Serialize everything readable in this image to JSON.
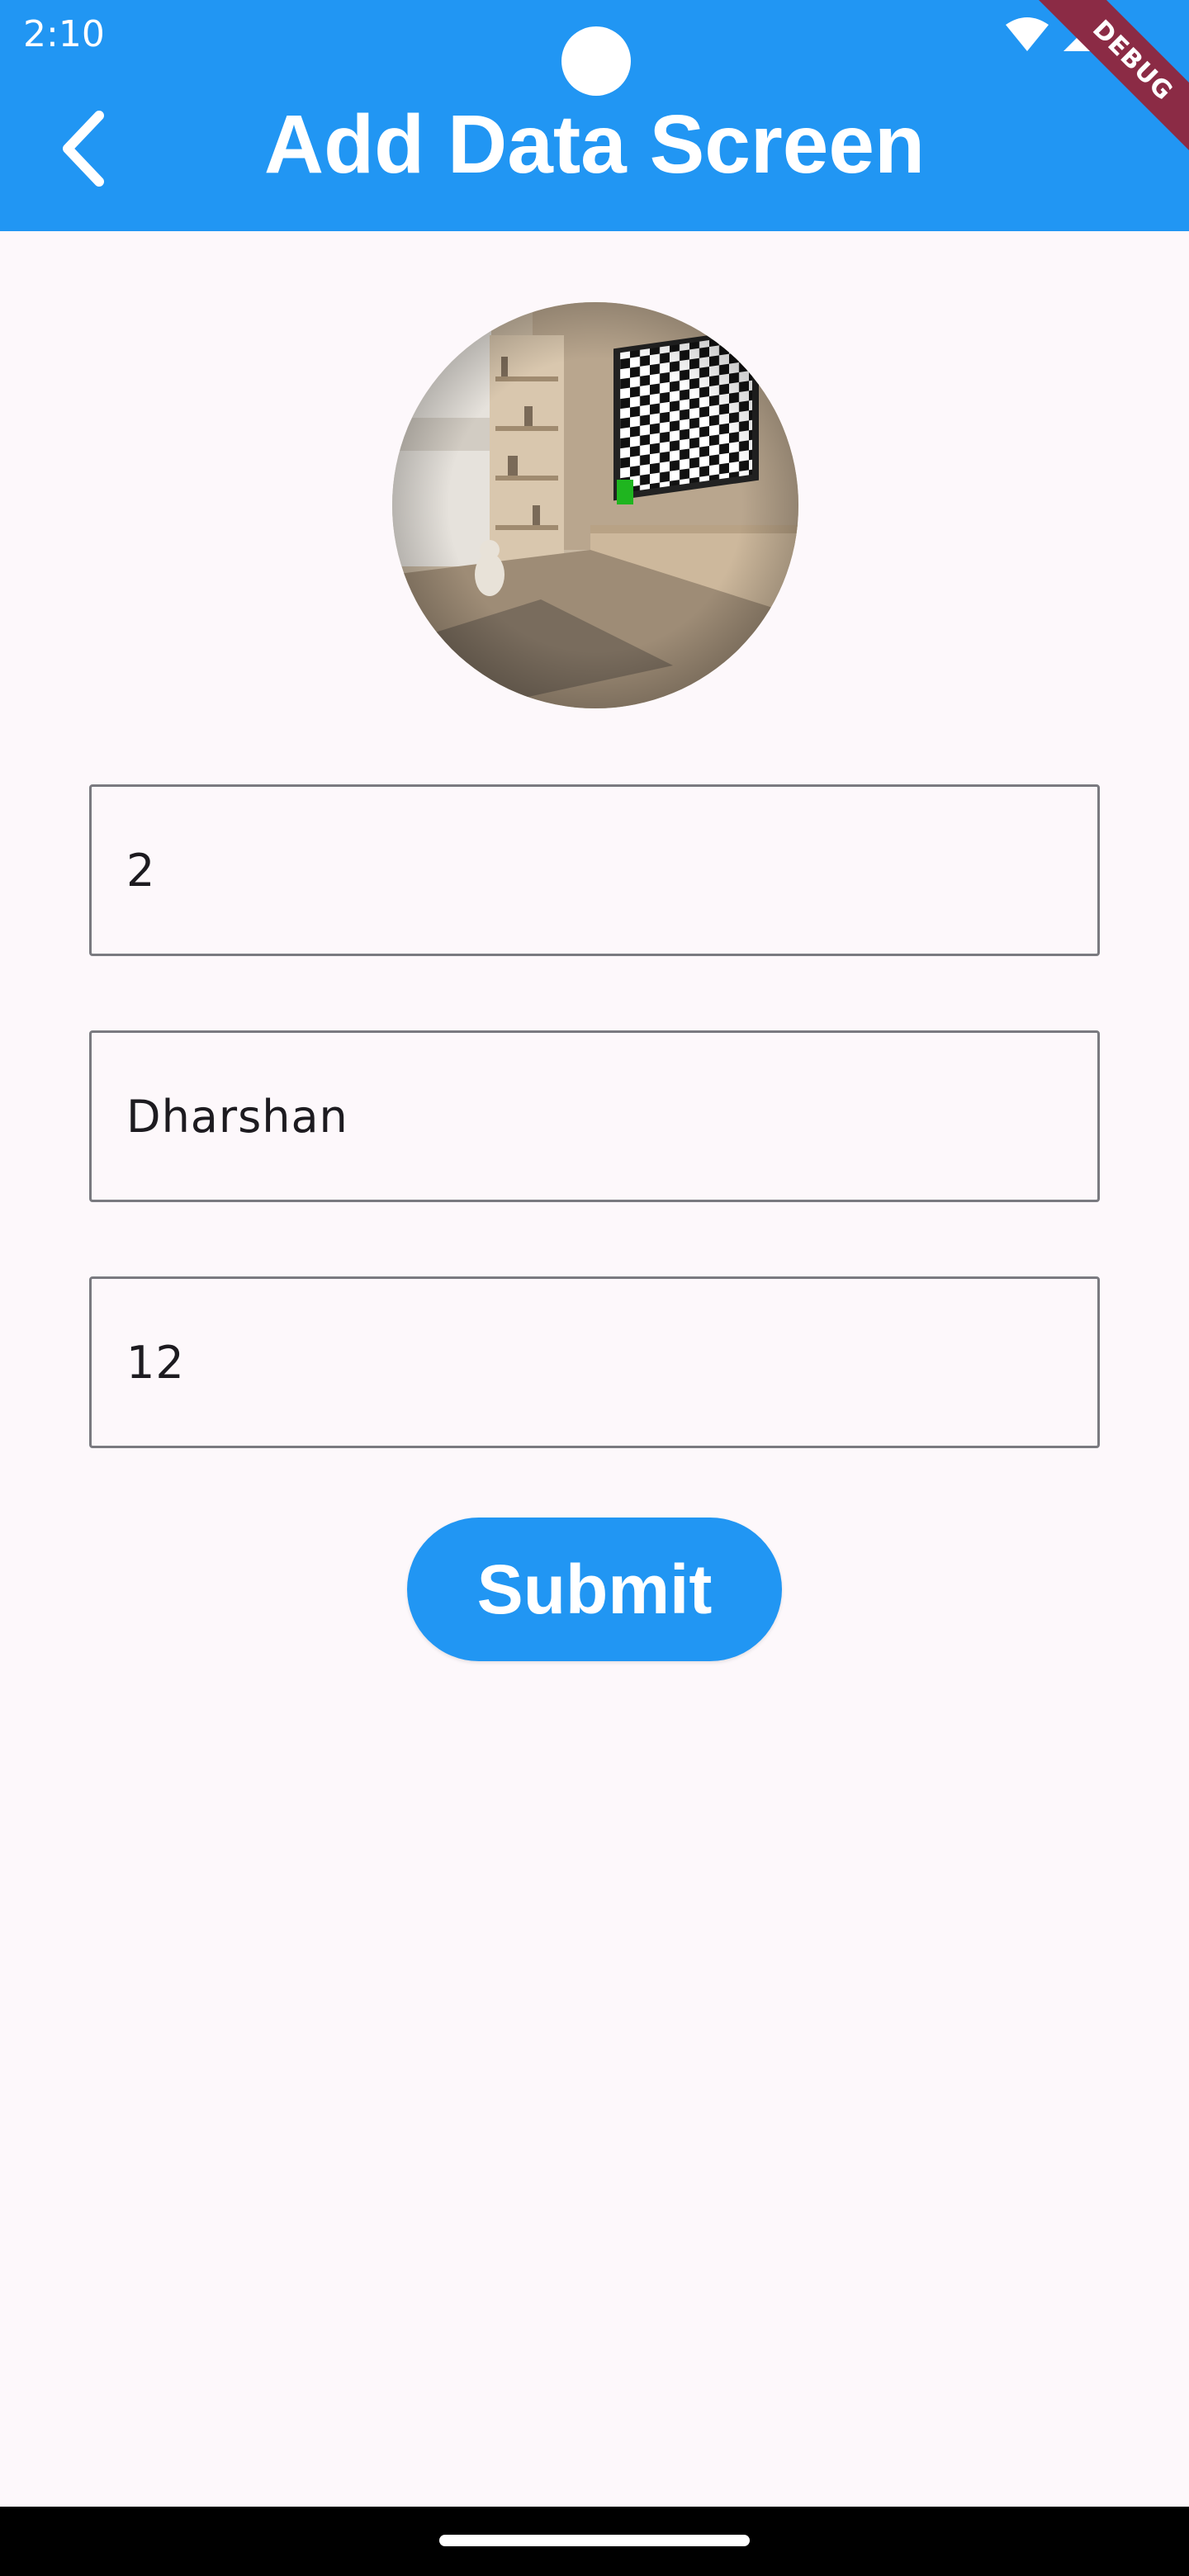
{
  "status_bar": {
    "time": "2:10",
    "icons": [
      "wifi-icon",
      "signal-icon"
    ],
    "debug_label": "DEBUG"
  },
  "app_bar": {
    "title": "Add Data Screen",
    "back_icon": "chevron-left-icon",
    "background_color": "#2196f3"
  },
  "avatar": {
    "description_icon": "room-photo"
  },
  "form": {
    "fields": [
      {
        "value": "2"
      },
      {
        "value": "Dharshan"
      },
      {
        "value": "12"
      }
    ],
    "submit_label": "Submit"
  },
  "colors": {
    "accent": "#2196f3",
    "background": "#fdf8fb",
    "debug_ribbon": "#8b2b45"
  }
}
